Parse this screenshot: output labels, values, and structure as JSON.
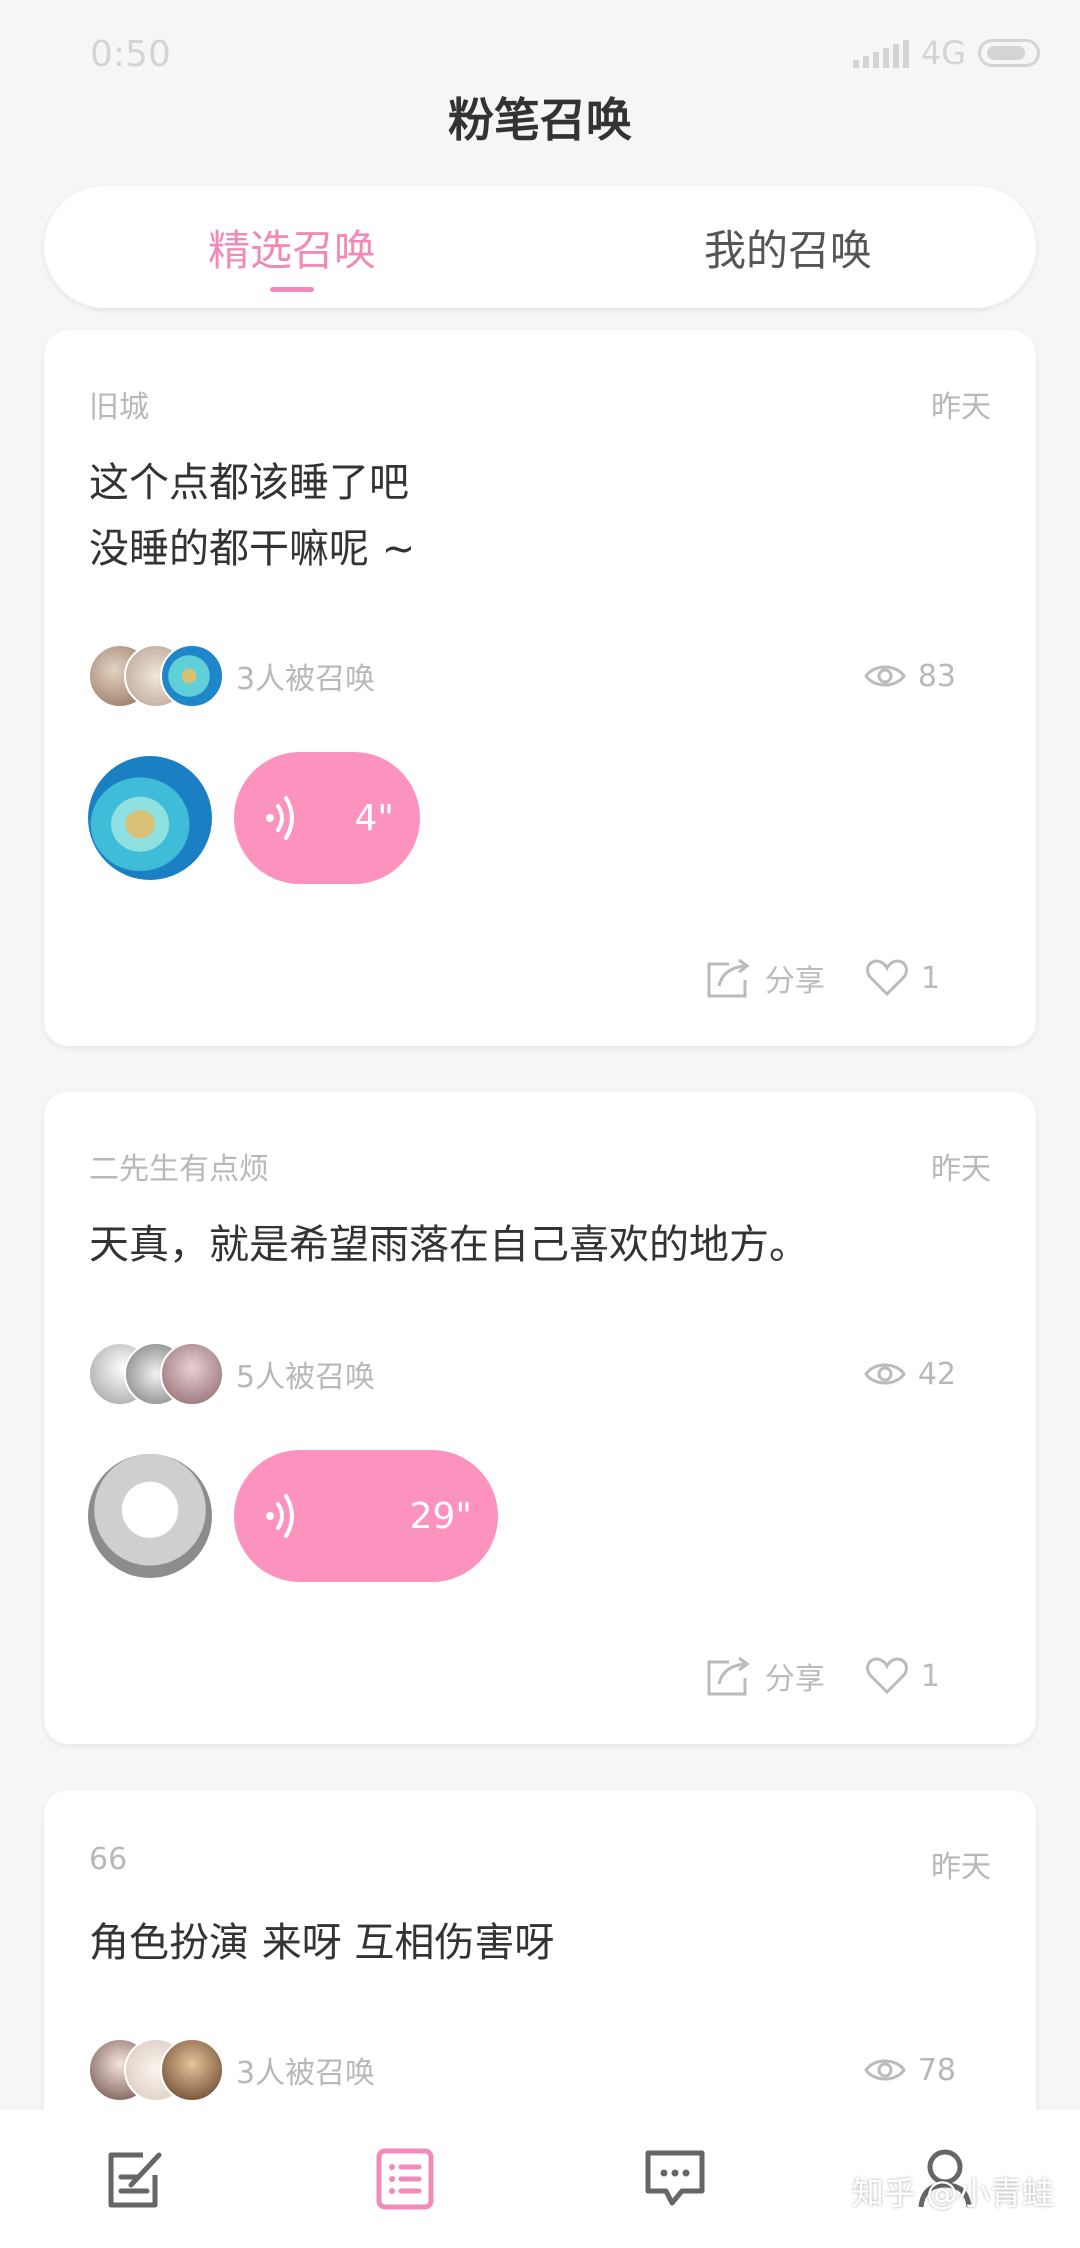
{
  "status_bar": {
    "time": "0:50",
    "network": "4G"
  },
  "header": {
    "title": "粉笔召唤"
  },
  "tabs": [
    {
      "label": "精选召唤",
      "active": true
    },
    {
      "label": "我的召唤",
      "active": false
    }
  ],
  "posts": [
    {
      "author": "旧城",
      "time": "昨天",
      "text_lines": [
        "这个点都该睡了吧",
        "没睡的都干嘛呢 ~"
      ],
      "summon_text": "3人被召唤",
      "views": "83",
      "voice_duration": "4\"",
      "share_label": "分享",
      "likes": "1"
    },
    {
      "author": "二先生有点烦",
      "time": "昨天",
      "text_lines": [
        "天真，就是希望雨落在自己喜欢的地方。"
      ],
      "summon_text": "5人被召唤",
      "views": "42",
      "voice_duration": "29\"",
      "share_label": "分享",
      "likes": "1"
    },
    {
      "author": "66",
      "time": "昨天",
      "text_lines": [
        "角色扮演 来呀 互相伤害呀"
      ],
      "summon_text": "3人被召唤",
      "views": "78"
    }
  ],
  "bottom_nav": [
    {
      "icon": "edit-icon"
    },
    {
      "icon": "list-icon",
      "active": true
    },
    {
      "icon": "message-icon"
    },
    {
      "icon": "profile-icon"
    }
  ],
  "watermark": "知乎 @小青蛙",
  "colors": {
    "accent": "#f08ab8",
    "voice_bubble": "#fb93be"
  }
}
